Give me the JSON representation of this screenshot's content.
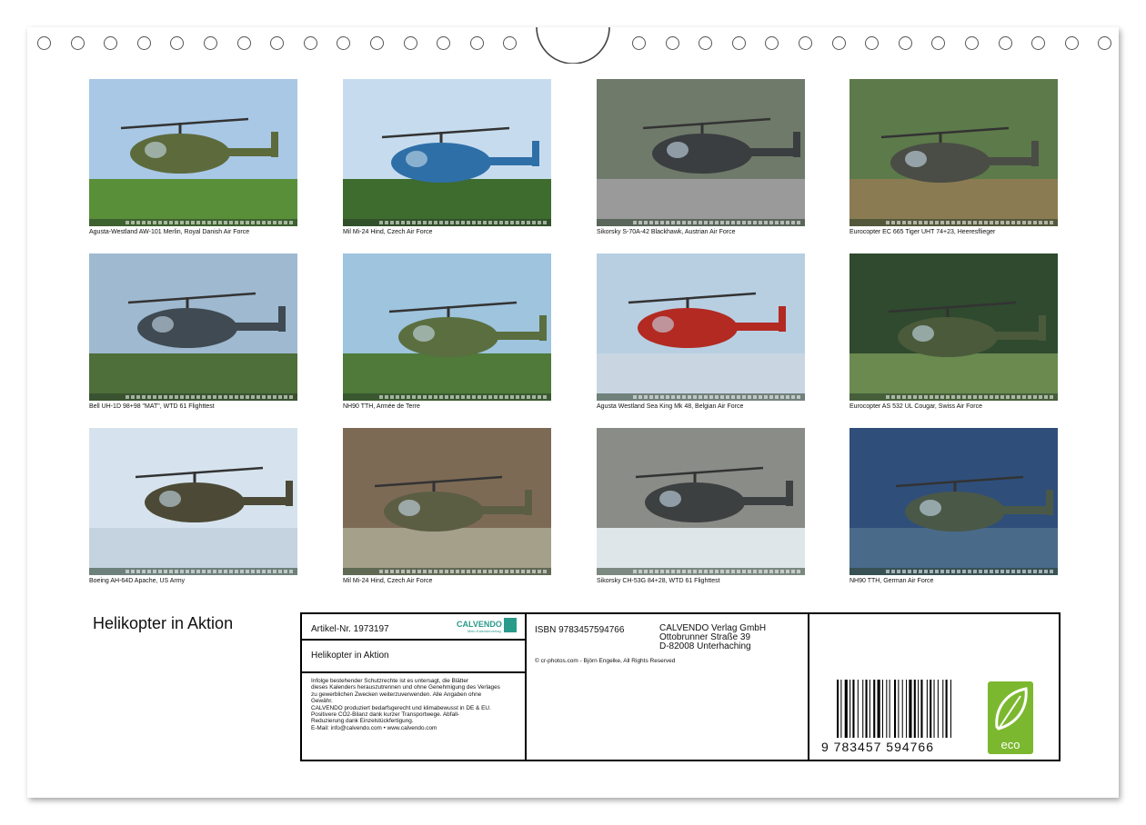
{
  "title": "Helikopter in Aktion",
  "photos": [
    {
      "caption": "Agusta-Westland AW-101 Merlin, Royal Danish Air Force",
      "sky": "#a8c8e6",
      "ground": "#5a8f3a",
      "body": "#5d6b3c"
    },
    {
      "caption": "Mil Mi-24 Hind, Czech Air Force",
      "sky": "#c6dcee",
      "ground": "#3e6b2e",
      "body": "#2f6fa8"
    },
    {
      "caption": "Sikorsky S-70A-42 Blackhawk, Austrian Air Force",
      "sky": "#6f7a6a",
      "ground": "#9a9a9a",
      "body": "#3a3e40"
    },
    {
      "caption": "Eurocopter EC 665 Tiger UHT 74+23, Heeresflieger",
      "sky": "#5d7a4a",
      "ground": "#8a7b52",
      "body": "#4a4d45"
    },
    {
      "caption": "Bell UH-1D 98+98 \"MAT\", WTD 61 Flighttest",
      "sky": "#9fb9d0",
      "ground": "#4e6e3a",
      "body": "#3f4a52"
    },
    {
      "caption": "NH90 TTH, Armée de Terre",
      "sky": "#9ec4de",
      "ground": "#4f7a3a",
      "body": "#5b6e3f"
    },
    {
      "caption": "Agusta Westland Sea King Mk 48, Belgian Air Force",
      "sky": "#b8cfe2",
      "ground": "#c9d6e2",
      "body": "#b22a22"
    },
    {
      "caption": "Eurocopter AS 532 UL Cougar, Swiss Air Force",
      "sky": "#2f4a2e",
      "ground": "#6a8a50",
      "body": "#4a5a3a"
    },
    {
      "caption": "Boeing AH-64D Apache, US Army",
      "sky": "#d6e3ee",
      "ground": "#c4d3df",
      "body": "#4c4a36"
    },
    {
      "caption": "Mil Mi-24 Hind, Czech Air Force",
      "sky": "#7d6a55",
      "ground": "#a4a08a",
      "body": "#5c5e44"
    },
    {
      "caption": "Sikorsky CH-53G 84+28, WTD 61 Flighttest",
      "sky": "#8a8c88",
      "ground": "#dfe6ea",
      "body": "#3d4040"
    },
    {
      "caption": "NH90 TTH, German Air Force",
      "sky": "#2f4f7a",
      "ground": "#4a6a8a",
      "body": "#4a5848"
    }
  ],
  "info": {
    "article": "Artikel-Nr. 1973197",
    "logo_text": "CALVENDO",
    "logo_sub": "Mein Kalenderverlag",
    "product_title": "Helikopter in Aktion",
    "legal": [
      "Infolge bestehender Schutzrechte ist es untersagt, die Blätter",
      "dieses Kalenders herauszutrennen und ohne Genehmigung des Verlages",
      "zu gewerblichen Zwecken weiterzuverwenden. Alle Angaben ohne",
      "Gewähr.",
      "CALVENDO produziert bedarfsgerecht und klimabewusst in DE & EU.",
      "Positivere CO2-Bilanz dank kurzer Transportwege. Abfall-",
      "Reduzierung dank Einzelstückfertigung.",
      "E-Mail: info@calvendo.com • www.calvendo.com"
    ],
    "isbn": "ISBN 9783457594766",
    "publisher": [
      "CALVENDO Verlag GmbH",
      "Ottobrunner Straße 39",
      "D-82008 Unterhaching"
    ],
    "copyright": "© cr-photos.com - Björn Engelke, All Rights Reserved",
    "barcode_number": "9   783457   594766",
    "eco_label": "eco",
    "colors": {
      "calvendo_green": "#2a9a8a",
      "eco_green": "#7cb82f"
    }
  }
}
